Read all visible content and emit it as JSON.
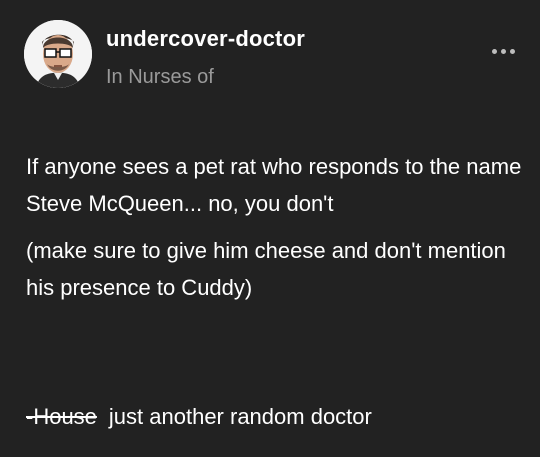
{
  "post": {
    "author": {
      "username": "undercover-doctor",
      "context": "In Nurses of",
      "avatar_icon": "doctor-avatar-icon"
    },
    "more_icon": "ellipsis-icon",
    "body": {
      "paragraphs": [
        "If anyone sees a pet rat who responds to the name Steve McQueen... no, you don't",
        "(make sure to give him cheese and don't mention his presence to Cuddy)"
      ],
      "signoff_struck": "-House",
      "signoff_text": "just another random doctor"
    }
  },
  "colors": {
    "background": "#222222",
    "text": "#ffffff",
    "muted_text": "#9a9a9a"
  }
}
